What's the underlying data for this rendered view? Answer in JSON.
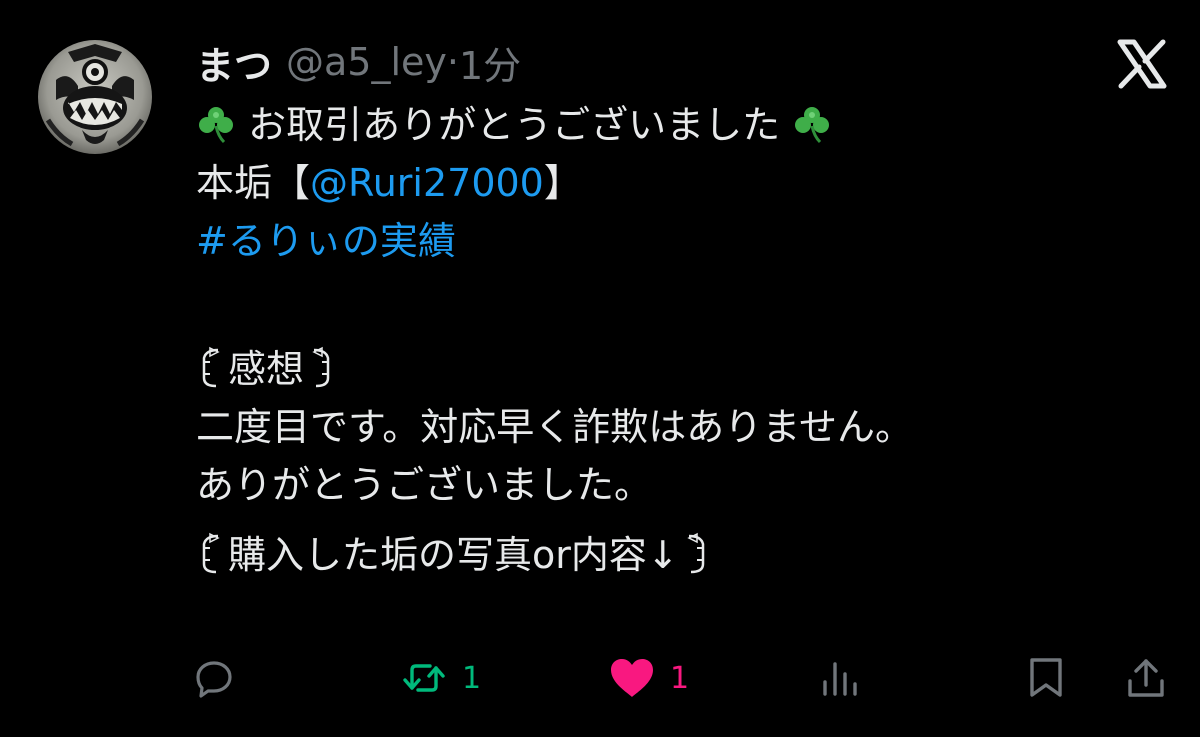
{
  "header": {
    "display_name": "まつ",
    "handle": "@a5_ley",
    "separator": "·",
    "time": "1分"
  },
  "tweet": {
    "line1_text": "お取引ありがとうございました",
    "line2_prefix": "本垢【",
    "mention": "@Ruri27000",
    "line2_suffix": "】",
    "hashtag": "#るりぃの実績",
    "section1_title": "感想",
    "review_line1": "二度目です。対応早く詐欺はありません。",
    "review_line2": "ありがとうございました。",
    "section2_title": "購入した垢の写真or内容↓"
  },
  "actions": {
    "reply_count": "",
    "retweet_count": "1",
    "like_count": "1",
    "view_count": ""
  },
  "colors": {
    "background": "#000000",
    "text": "#e7e9ea",
    "muted": "#71767b",
    "link": "#1d9bf0",
    "retweet": "#00ba7c",
    "like": "#f91880"
  },
  "icons": {
    "logo": "x-logo-icon",
    "clover": "shamrock-icon",
    "reply": "reply-icon",
    "retweet": "retweet-icon",
    "like": "heart-icon",
    "views": "analytics-icon",
    "bookmark": "bookmark-icon",
    "share": "share-icon"
  }
}
